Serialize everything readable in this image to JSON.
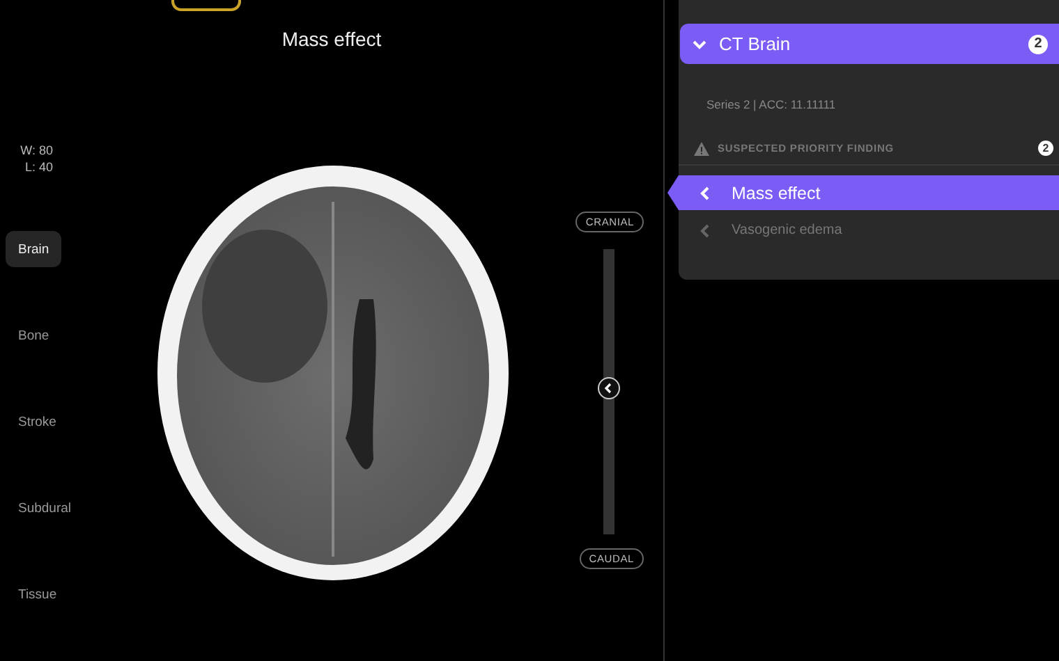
{
  "viewer": {
    "title": "Mass effect",
    "window_width": "W: 80",
    "window_level": "L: 40",
    "presets": [
      {
        "label": "Brain",
        "selected": true
      },
      {
        "label": "Bone",
        "selected": false
      },
      {
        "label": "Stroke",
        "selected": false
      },
      {
        "label": "Subdural",
        "selected": false
      },
      {
        "label": "Tissue",
        "selected": false
      }
    ],
    "slice_slider": {
      "top_label": "CRANIAL",
      "bottom_label": "CAUDAL",
      "level": 0.49
    }
  },
  "study_panel": {
    "study": {
      "title": "CT Brain",
      "expanded": true,
      "count": "2"
    },
    "series_info": "Series 2 | ACC: 11.11111",
    "priority": {
      "label": "SUSPECTED PRIORITY FINDING",
      "count": "2"
    },
    "findings": [
      {
        "label": "Mass effect",
        "selected": true
      },
      {
        "label": "Vasogenic edema",
        "selected": false
      }
    ]
  }
}
